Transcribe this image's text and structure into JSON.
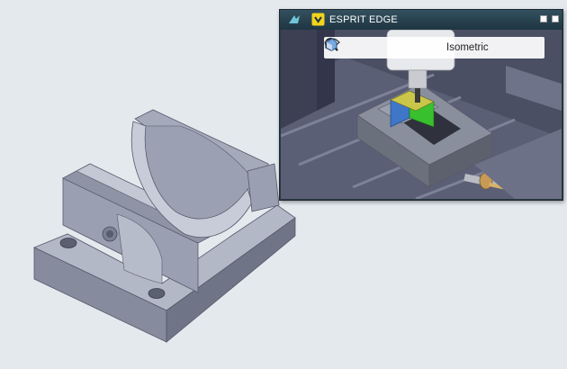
{
  "preview": {
    "title": "ESPRIT EDGE",
    "toolbar": {
      "view_label": "Isometric",
      "icons": [
        "rotate-icon",
        "pan-icon",
        "zoom-icon",
        "zoom-fit-icon",
        "view-cube-icon",
        "eye-icon",
        "display-mode-icon"
      ]
    }
  },
  "colors": {
    "background": "#e4e9ee",
    "part": "#a9afbf",
    "title_bar": "#26414f",
    "stock_yellow": "#c9c64a",
    "stock_green": "#39c02f",
    "stock_blue": "#3e76c8"
  }
}
